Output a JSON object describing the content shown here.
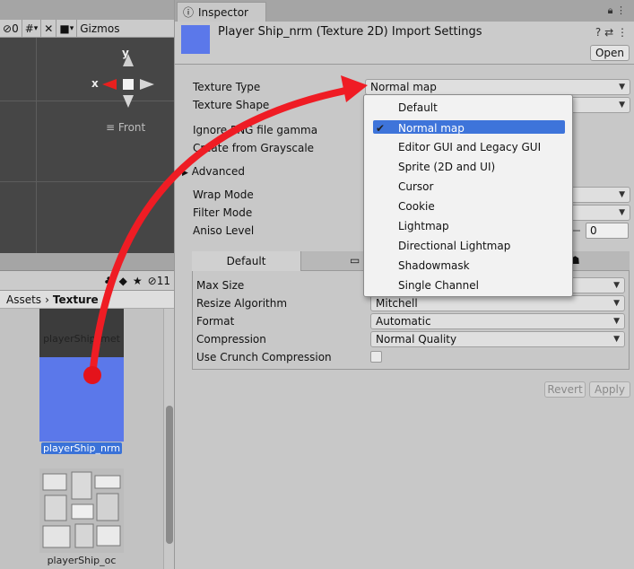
{
  "scene": {
    "toolbar": {
      "hidden_count": "0",
      "gizmos_label": "Gizmos"
    },
    "axis_x": "x",
    "axis_y": "y",
    "view_label": "Front"
  },
  "project": {
    "layers_count": "11",
    "breadcrumb": {
      "root": "Assets",
      "separator": "›",
      "folder": "Texture"
    },
    "assets": [
      {
        "name": "playerShip_met"
      },
      {
        "name": "playerShip_nrm",
        "selected": true
      },
      {
        "name": "playerShip_oc"
      }
    ]
  },
  "inspector": {
    "tab_label": "Inspector",
    "title": "Player Ship_nrm (Texture 2D) Import Settings",
    "open_button": "Open",
    "fields": {
      "texture_type": "Texture Type",
      "texture_shape": "Texture Shape",
      "ignore_png": "Ignore PNG file gamma",
      "create_from_grayscale": "Create from Grayscale",
      "advanced": "Advanced",
      "wrap_mode": "Wrap Mode",
      "filter_mode": "Filter Mode",
      "aniso_level": "Aniso Level"
    },
    "texture_type_value": "Normal map",
    "aniso_value": "0",
    "platform": {
      "default_tab": "Default",
      "max_size": "Max Size",
      "resize_algorithm": "Resize Algorithm",
      "resize_algorithm_value": "Mitchell",
      "format": "Format",
      "format_value": "Automatic",
      "compression": "Compression",
      "compression_value": "Normal Quality",
      "use_crunch": "Use Crunch Compression"
    },
    "revert_button": "Revert",
    "apply_button": "Apply"
  },
  "menu": {
    "items": [
      {
        "label": "Default"
      },
      {
        "label": "Normal map",
        "checked": true
      },
      {
        "label": "Editor GUI and Legacy GUI"
      },
      {
        "label": "Sprite (2D and UI)"
      },
      {
        "label": "Cursor"
      },
      {
        "label": "Cookie"
      },
      {
        "label": "Lightmap"
      },
      {
        "label": "Directional Lightmap"
      },
      {
        "label": "Shadowmask"
      },
      {
        "label": "Single Channel"
      }
    ]
  },
  "colors": {
    "annotation_arrow": "#ef1c24",
    "normal_map_blue": "#5b78ea",
    "selection_blue": "#3e74da"
  }
}
